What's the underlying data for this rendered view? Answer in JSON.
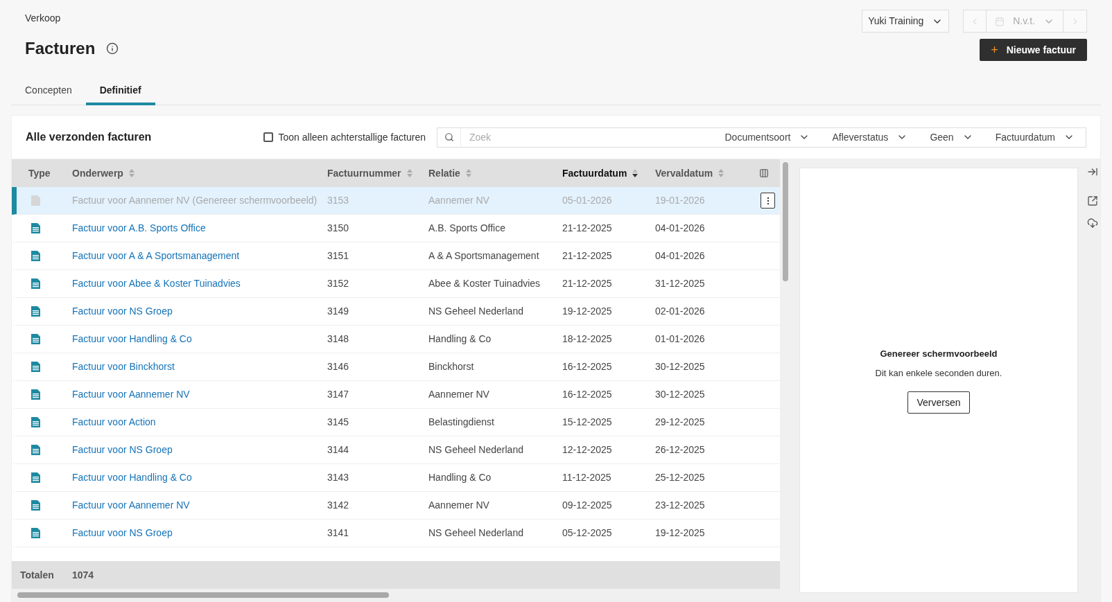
{
  "breadcrumb": "Verkoop",
  "title": "Facturen",
  "company_select": {
    "value": "Yuki Training"
  },
  "period_select": {
    "value": "N.v.t.",
    "disabled": true
  },
  "new_button": {
    "label": "Nieuwe factuur",
    "icon": "+"
  },
  "tabs": [
    {
      "label": "Concepten",
      "selected": false
    },
    {
      "label": "Definitief",
      "selected": true
    }
  ],
  "card": {
    "title": "Alle verzonden facturen",
    "overdue_filter": {
      "label": "Toon alleen achterstallige facturen",
      "checked": false
    },
    "search": {
      "placeholder": "Zoek"
    },
    "filters": [
      "Documentsoort",
      "Afleverstatus",
      "Geen",
      "Factuurdatum"
    ]
  },
  "table": {
    "type_column": "Type",
    "columns": [
      {
        "label": "Onderwerp",
        "sorted": false
      },
      {
        "label": "Factuurnummer",
        "sorted": false
      },
      {
        "label": "Relatie",
        "sorted": false
      },
      {
        "label": "Factuurdatum",
        "sorted": true
      },
      {
        "label": "Vervaldatum",
        "sorted": false
      }
    ],
    "rows": [
      {
        "kind": "pending",
        "selected": true,
        "cells": [
          "Factuur voor Aannemer NV (Genereer schermvoorbeeld)",
          "3153",
          "Aannemer NV",
          "05-01-2026",
          "19-01-2026"
        ]
      },
      {
        "kind": "document",
        "selected": false,
        "cells": [
          "Factuur voor A.B. Sports Office",
          "3150",
          "A.B. Sports Office",
          "21-12-2025",
          "04-01-2026"
        ]
      },
      {
        "kind": "document",
        "selected": false,
        "cells": [
          "Factuur voor A & A Sportsmanagement",
          "3151",
          "A & A Sportsmanagement",
          "21-12-2025",
          "04-01-2026"
        ]
      },
      {
        "kind": "document",
        "selected": false,
        "cells": [
          "Factuur voor Abee & Koster Tuinadvies",
          "3152",
          "Abee & Koster Tuinadvies",
          "21-12-2025",
          "31-12-2025"
        ]
      },
      {
        "kind": "document",
        "selected": false,
        "cells": [
          "Factuur voor NS Groep",
          "3149",
          "NS Geheel Nederland",
          "19-12-2025",
          "02-01-2026"
        ]
      },
      {
        "kind": "document",
        "selected": false,
        "cells": [
          "Factuur voor Handling & Co",
          "3148",
          "Handling & Co",
          "18-12-2025",
          "01-01-2026"
        ]
      },
      {
        "kind": "document",
        "selected": false,
        "cells": [
          "Factuur voor Binckhorst",
          "3146",
          "Binckhorst",
          "16-12-2025",
          "30-12-2025"
        ]
      },
      {
        "kind": "document",
        "selected": false,
        "cells": [
          "Factuur voor Aannemer NV",
          "3147",
          "Aannemer NV",
          "16-12-2025",
          "30-12-2025"
        ]
      },
      {
        "kind": "document",
        "selected": false,
        "cells": [
          "Factuur voor Action",
          "3145",
          "Belastingdienst",
          "15-12-2025",
          "29-12-2025"
        ]
      },
      {
        "kind": "document",
        "selected": false,
        "cells": [
          "Factuur voor NS Groep",
          "3144",
          "NS Geheel Nederland",
          "12-12-2025",
          "26-12-2025"
        ]
      },
      {
        "kind": "document",
        "selected": false,
        "cells": [
          "Factuur voor Handling & Co",
          "3143",
          "Handling & Co",
          "11-12-2025",
          "25-12-2025"
        ]
      },
      {
        "kind": "document",
        "selected": false,
        "cells": [
          "Factuur voor Aannemer NV",
          "3142",
          "Aannemer NV",
          "09-12-2025",
          "23-12-2025"
        ]
      },
      {
        "kind": "document",
        "selected": false,
        "cells": [
          "Factuur voor NS Groep",
          "3141",
          "NS Geheel Nederland",
          "05-12-2025",
          "19-12-2025"
        ]
      }
    ],
    "totals": {
      "label": "Totalen",
      "value": "1074"
    }
  },
  "preview": {
    "title": "Genereer schermvoorbeeld",
    "message": "Dit kan enkele seconden duren.",
    "button": "Verversen"
  }
}
